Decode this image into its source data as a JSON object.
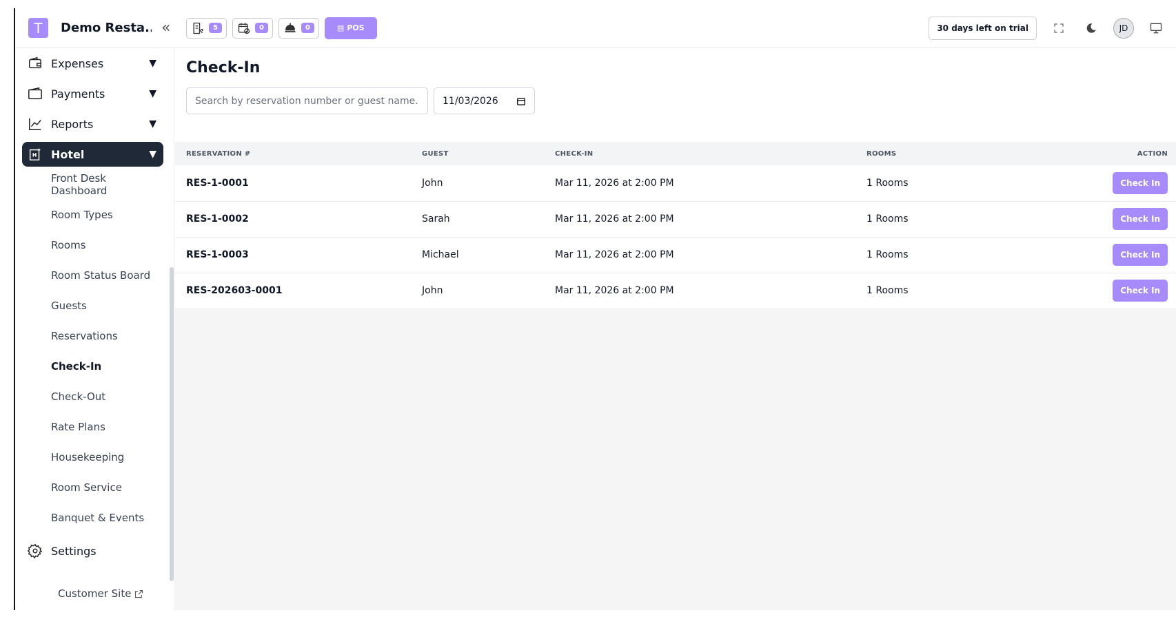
{
  "app": {
    "name": "Demo Resta...",
    "logo_letter": "T"
  },
  "header": {
    "pill_counts": [
      "5",
      "0",
      "0"
    ],
    "pos_label": "POS",
    "trial_text": "30 days left on trial",
    "avatar_initials": "JD"
  },
  "sidebar": {
    "top_items": [
      {
        "label": "Expenses",
        "icon": "wallet-icon"
      },
      {
        "label": "Payments",
        "icon": "folder-icon"
      },
      {
        "label": "Reports",
        "icon": "chart-icon"
      }
    ],
    "active_item": {
      "label": "Hotel",
      "icon": "hotel-icon"
    },
    "sub_items": [
      "Front Desk Dashboard",
      "Room Types",
      "Rooms",
      "Room Status Board",
      "Guests",
      "Reservations",
      "Check-In",
      "Check-Out",
      "Rate Plans",
      "Housekeeping",
      "Room Service",
      "Banquet & Events"
    ],
    "current_sub": "Check-In",
    "settings_label": "Settings",
    "customer_site": "Customer Site"
  },
  "main": {
    "title": "Check-In",
    "search_placeholder": "Search by reservation number or guest name...",
    "date_value": "11/03/2026",
    "columns": [
      "RESERVATION #",
      "GUEST",
      "CHECK-IN",
      "ROOMS",
      "ACTION"
    ],
    "rows": [
      {
        "reservation": "RES-1-0001",
        "guest": "John",
        "checkin": "Mar 11, 2026 at 2:00 PM",
        "rooms": "1 Rooms",
        "action": "Check In"
      },
      {
        "reservation": "RES-1-0002",
        "guest": "Sarah",
        "checkin": "Mar 11, 2026 at 2:00 PM",
        "rooms": "1 Rooms",
        "action": "Check In"
      },
      {
        "reservation": "RES-1-0003",
        "guest": "Michael",
        "checkin": "Mar 11, 2026 at 2:00 PM",
        "rooms": "1 Rooms",
        "action": "Check In"
      },
      {
        "reservation": "RES-202603-0001",
        "guest": "John",
        "checkin": "Mar 11, 2026 at 2:00 PM",
        "rooms": "1 Rooms",
        "action": "Check In"
      }
    ]
  },
  "colors": {
    "accent": "#a78bfa",
    "active_nav": "#1f2937"
  }
}
